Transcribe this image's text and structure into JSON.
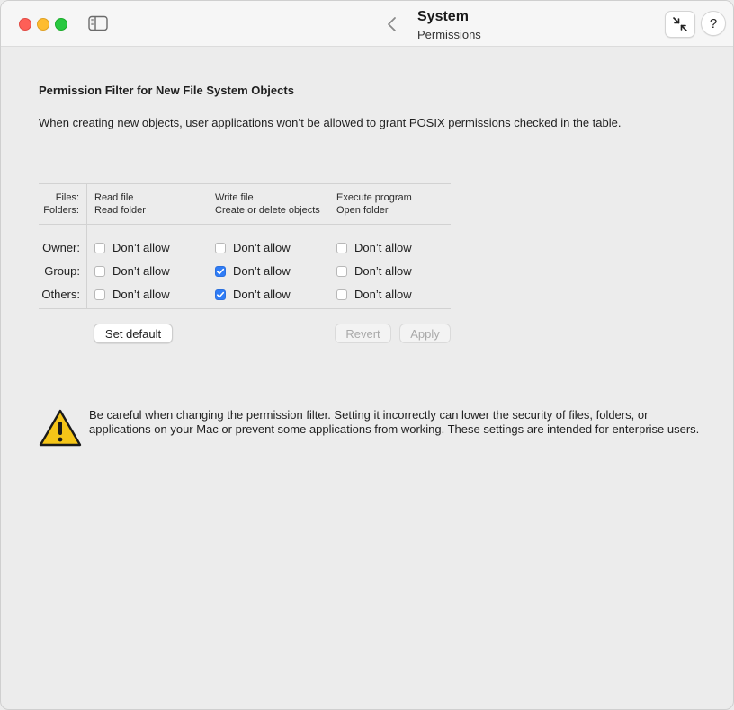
{
  "window": {
    "title": "System",
    "subtitle": "Permissions",
    "help_label": "?"
  },
  "filter": {
    "title": "Permission Filter for New File System Objects",
    "description": "When creating new objects, user applications won’t be allowed to grant POSIX permissions checked in the table."
  },
  "table": {
    "header_labels": {
      "files": "Files:",
      "folders": "Folders:"
    },
    "columns": [
      {
        "files": "Read file",
        "folders": "Read folder"
      },
      {
        "files": "Write file",
        "folders": "Create or delete objects"
      },
      {
        "files": "Execute program",
        "folders": "Open folder"
      }
    ],
    "rows": [
      {
        "label": "Owner:",
        "cells": [
          {
            "label": "Don’t allow",
            "checked": false
          },
          {
            "label": "Don’t allow",
            "checked": false
          },
          {
            "label": "Don’t allow",
            "checked": false
          }
        ]
      },
      {
        "label": "Group:",
        "cells": [
          {
            "label": "Don’t allow",
            "checked": false
          },
          {
            "label": "Don’t allow",
            "checked": true
          },
          {
            "label": "Don’t allow",
            "checked": false
          }
        ]
      },
      {
        "label": "Others:",
        "cells": [
          {
            "label": "Don’t allow",
            "checked": false
          },
          {
            "label": "Don’t allow",
            "checked": true
          },
          {
            "label": "Don’t allow",
            "checked": false
          }
        ]
      }
    ]
  },
  "buttons": {
    "set_default": "Set default",
    "revert": "Revert",
    "apply": "Apply"
  },
  "warning": {
    "icon": "warning-triangle-icon",
    "text": "Be careful when changing the permission filter. Setting it incorrectly can lower the security of files, folders, or applications on your Mac or prevent some applications from working. These settings are intended for enterprise users."
  },
  "colors": {
    "accent": "#2f7cf6",
    "warning_yellow": "#f5c518"
  }
}
